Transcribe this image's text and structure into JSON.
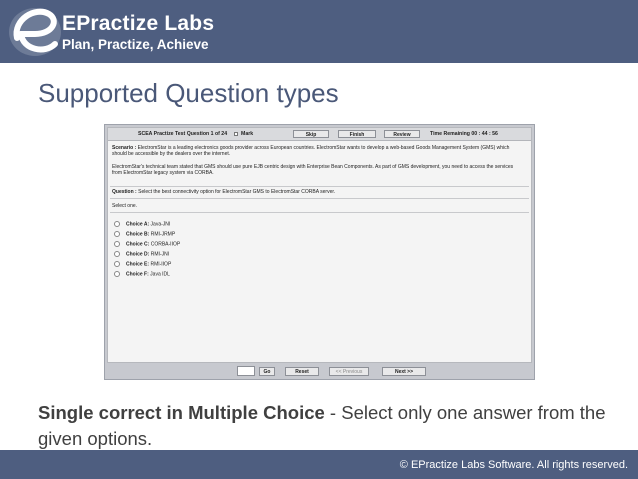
{
  "header": {
    "brand": "EPractize Labs",
    "tagline": "Plan, Practize, Achieve",
    "logo_letter": "e"
  },
  "slide_title": "Supported Question types",
  "screenshot": {
    "topbar": {
      "title": "SCEA Practize Test Question 1 of 24",
      "mark_label": "Mark",
      "skip": "Skip",
      "finish": "Finish",
      "review": "Review",
      "time_remaining": "Time Remaining 00 : 44 : 56"
    },
    "scenario_label": "Scenario :",
    "scenario_text": "ElectromStar is a leading electronics goods provider across European countries. ElectromStar wants to develop a web-based Goods Management System (GMS) which should be accessible by the dealers over the internet.",
    "scenario_text_2": "ElectromStar's technical team stated that GMS should use pure EJB centric design with Enterprise Bean Components. As part of GMS development, you need to access the services from ElectromStar legacy system via CORBA.",
    "question_label": "Question :",
    "question_text": "Select the best connectivity option for ElectromStar GMS to ElectromStar CORBA server.",
    "instruction": "Select one.",
    "choices": [
      {
        "label": "Choice A:",
        "text": "Java-JNI"
      },
      {
        "label": "Choice B:",
        "text": "RMI-JRMP"
      },
      {
        "label": "Choice C:",
        "text": "CORBA-IIOP"
      },
      {
        "label": "Choice D:",
        "text": "RMI-JNI"
      },
      {
        "label": "Choice E:",
        "text": "RMI-IIOP"
      },
      {
        "label": "Choice F:",
        "text": "Java IDL"
      }
    ],
    "bottombar": {
      "go": "Go",
      "reset": "Reset",
      "previous": "<< Previous",
      "next": "Next >>"
    }
  },
  "caption": {
    "bold": "Single correct in Multiple Choice",
    "rest": " - Select only one answer from the given options."
  },
  "footer": {
    "copyright": "© EPractize Labs Software. All rights  reserved."
  },
  "colors": {
    "banner": "#4e5e80",
    "title": "#4a5878"
  }
}
